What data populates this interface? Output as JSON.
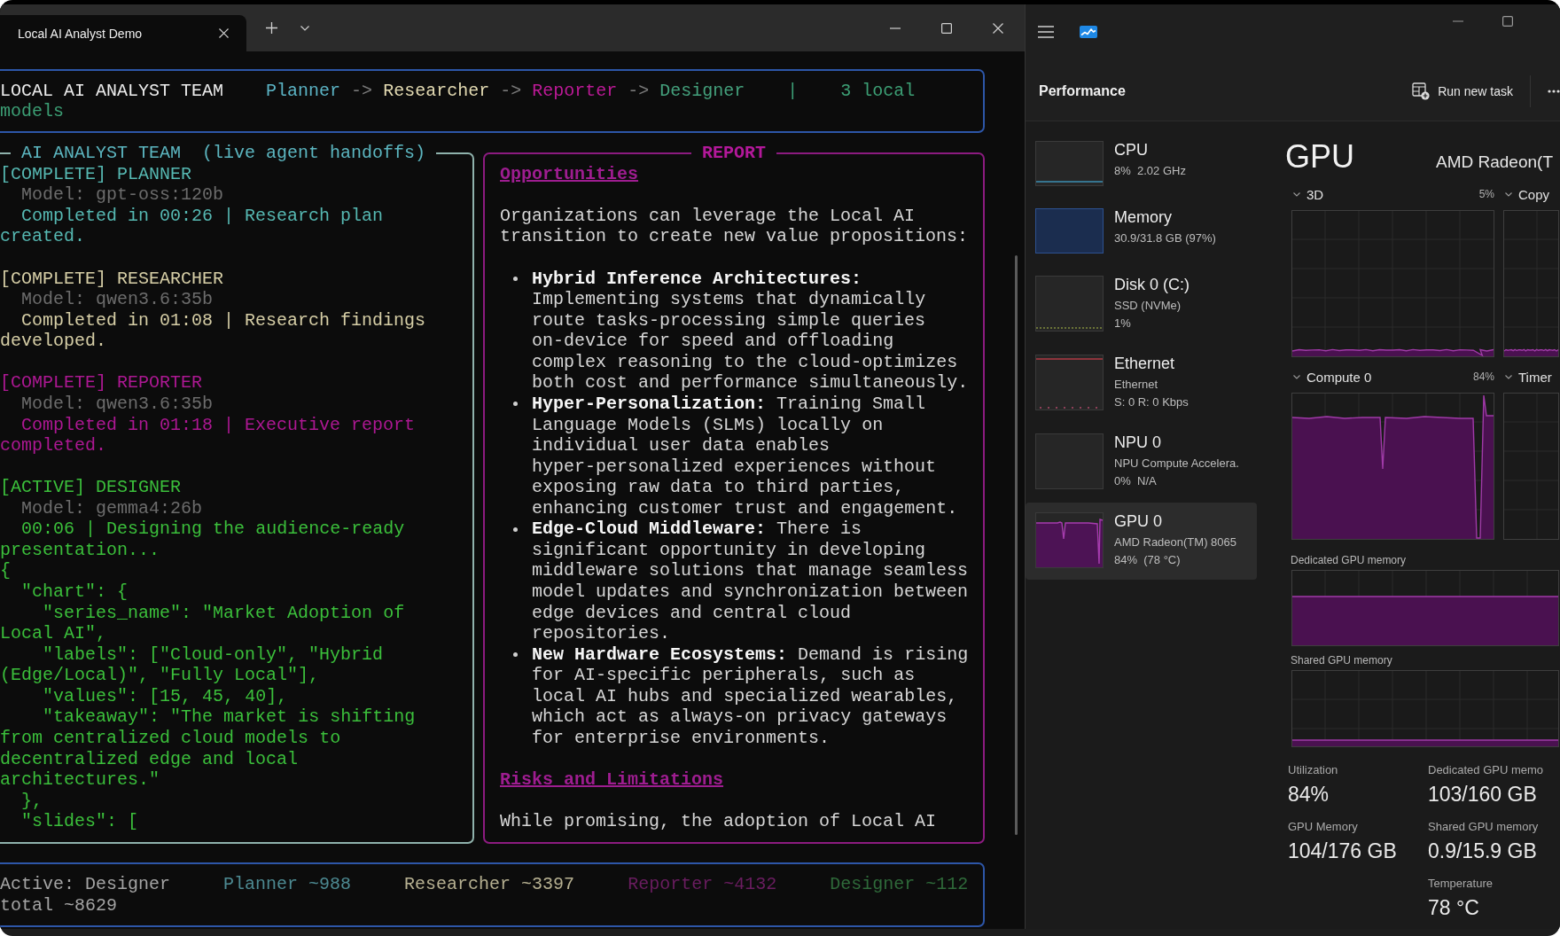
{
  "terminal": {
    "tabs": [
      {
        "label": "Local AI Analyst Demo",
        "selected": true
      }
    ],
    "header": {
      "title": "LOCAL AI ANALYST TEAM",
      "pipeline": [
        {
          "kind": "agent",
          "label": "Planner",
          "color": "#5bb3c4"
        },
        {
          "kind": "arrow",
          "label": "->"
        },
        {
          "kind": "agent",
          "label": "Researcher",
          "color": "#e3dab2"
        },
        {
          "kind": "arrow",
          "label": "->"
        },
        {
          "kind": "agent",
          "label": "Reporter",
          "color": "#bd1a97"
        },
        {
          "kind": "arrow",
          "label": "->"
        },
        {
          "kind": "agent",
          "label": "Designer",
          "color": "#44a07c"
        }
      ],
      "separator": "|",
      "models": "3 local models"
    },
    "agents_panel": {
      "title": "AI ANALYST TEAM  (live agent handoffs)",
      "agents": [
        {
          "heading": "[COMPLETE] PLANNER",
          "model": "Model: gpt-oss:120b",
          "message": "Completed in 00:26 | Research plan created.",
          "color": "#56b8b2"
        },
        {
          "heading": "[COMPLETE] RESEARCHER",
          "model": "Model: qwen3.6:35b",
          "message": "Completed in 01:08 | Research findings developed.",
          "color": "#d6cea6"
        },
        {
          "heading": "[COMPLETE] REPORTER",
          "model": "Model: qwen3.6:35b",
          "message": "Completed in 01:18 | Executive report completed.",
          "color": "#ad1893"
        },
        {
          "heading": "[ACTIVE] DESIGNER",
          "model": "Model: gemma4:26b",
          "message": "00:06 | Designing the audience-ready presentation...",
          "color": "#3bbf3b",
          "output": "{\n  \"chart\": {\n    \"series_name\": \"Market Adoption of Local AI\",\n    \"labels\": [\"Cloud-only\", \"Hybrid (Edge/Local)\", \"Fully Local\"],\n    \"values\": [15, 45, 40],\n    \"takeaway\": \"The market is shifting from centralized cloud models to decentralized edge and local architectures.\"\n  },\n  \"slides\": ["
        }
      ]
    },
    "report_panel": {
      "title": "REPORT",
      "blocks": [
        {
          "kind": "heading",
          "text": "Opportunities"
        },
        {
          "kind": "paragraph",
          "text": "Organizations can leverage the Local AI transition to create new value propositions:"
        },
        {
          "kind": "bullets",
          "items": [
            "**Hybrid Inference Architectures:** Implementing systems that dynamically route tasks-processing simple queries on-device for speed and offloading complex reasoning to the cloud-optimizes both cost and performance simultaneously.",
            "**Hyper-Personalization:** Training Small Language Models (SLMs) locally on individual user data enables hyper-personalized experiences without exposing raw data to third parties, enhancing customer trust and engagement.",
            "**Edge-Cloud Middleware:** There is significant opportunity in developing middleware solutions that manage seamless model updates and synchronization between edge devices and central cloud repositories.",
            "**New Hardware Ecosystems:** Demand is rising for AI-specific peripherals, such as local AI hubs and specialized wearables, which act as always-on privacy gateways for enterprise environments."
          ]
        },
        {
          "kind": "heading",
          "text": "Risks and Limitations"
        },
        {
          "kind": "paragraph",
          "text": "While promising, the adoption of Local AI"
        }
      ]
    },
    "status_bar": {
      "items": [
        {
          "label": "Active: Designer",
          "color": "#a4a4a4"
        },
        {
          "label": "Planner ~988",
          "color": "#4d8a92"
        },
        {
          "label": "Researcher ~3397",
          "color": "#b6b091"
        },
        {
          "label": "Reporter ~4132",
          "color": "#6a1d60"
        },
        {
          "label": "Designer ~112",
          "color": "#2f6a3a"
        },
        {
          "label": "total ~8629",
          "color": "#a4a4a4"
        }
      ]
    }
  },
  "task_manager": {
    "title": "Performance",
    "run_task": "Run new task",
    "devices": [
      {
        "kind": "cpu",
        "name": "CPU",
        "details": [
          "8%  2.02 GHz"
        ],
        "selected": false
      },
      {
        "kind": "memory",
        "name": "Memory",
        "details": [
          "30.9/31.8 GB (97%)"
        ],
        "selected": false
      },
      {
        "kind": "disk",
        "name": "Disk 0 (C:)",
        "details": [
          "SSD (NVMe)",
          "1%"
        ],
        "selected": false
      },
      {
        "kind": "ethernet",
        "name": "Ethernet",
        "details": [
          "Ethernet",
          "S: 0 R: 0 Kbps"
        ],
        "selected": false
      },
      {
        "kind": "npu",
        "name": "NPU 0",
        "details": [
          "NPU Compute Accelera.",
          "0%  N/A"
        ],
        "selected": false
      },
      {
        "kind": "gpu",
        "name": "GPU 0",
        "details": [
          "AMD Radeon(TM) 8065",
          "84%  (78 °C)"
        ],
        "selected": true
      }
    ],
    "detail": {
      "title": "GPU",
      "device": "AMD Radeon(T",
      "engines": [
        {
          "label": "3D",
          "reading": "5%",
          "kind": "flat"
        },
        {
          "label": "Copy",
          "kind": "flat"
        },
        {
          "label": "Compute 0",
          "reading": "84%",
          "kind": "busy"
        },
        {
          "label": "Timer",
          "kind": "idle"
        }
      ],
      "memory_graphs": [
        {
          "label": "Dedicated GPU memory",
          "kind": "high"
        },
        {
          "label": "Shared GPU memory",
          "kind": "low"
        }
      ],
      "stat_columns": [
        [
          {
            "label": "Utilization",
            "value": "84%"
          },
          {
            "label": "GPU Memory",
            "value": "104/176 GB"
          }
        ],
        [
          {
            "label": "Dedicated GPU memo",
            "value": "103/160 GB"
          },
          {
            "label": "Shared GPU memory",
            "value": "0.9/15.9 GB"
          },
          {
            "label": "Temperature",
            "value": "78 °C"
          }
        ]
      ]
    }
  }
}
